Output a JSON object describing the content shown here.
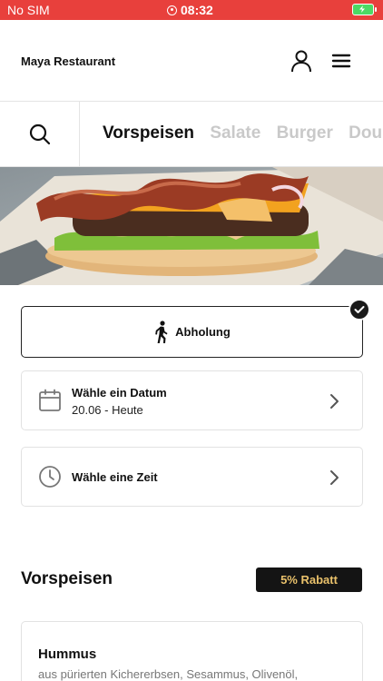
{
  "status_bar": {
    "carrier": "No SIM",
    "time": "08:32"
  },
  "header": {
    "brand": "Maya Restaurant"
  },
  "categories": [
    "Vorspeisen",
    "Salate",
    "Burger",
    "Double"
  ],
  "pickup": {
    "label": "Abholung"
  },
  "date_card": {
    "title": "Wähle ein Datum",
    "value": "20.06 - Heute"
  },
  "time_card": {
    "title": "Wähle eine Zeit"
  },
  "section": {
    "title": "Vorspeisen",
    "badge": "5% Rabatt"
  },
  "products": [
    {
      "name": "Hummus",
      "description": "aus pürierten Kichererbsen, Sesammus, Olivenöl,"
    }
  ],
  "colors": {
    "status_bar": "#e8403c",
    "badge_bg": "#141414",
    "badge_text": "#e9c16b",
    "battery": "#4cd964"
  },
  "icons": [
    "search-icon",
    "user-icon",
    "menu-icon",
    "walking-icon",
    "check-icon",
    "calendar-icon",
    "clock-icon",
    "chevron-right-icon"
  ]
}
